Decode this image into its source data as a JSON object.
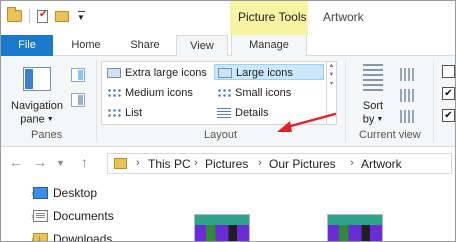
{
  "title_bar": {
    "context_tab": "Picture Tools",
    "window_title": "Artwork"
  },
  "tabs": [
    {
      "label": "File"
    },
    {
      "label": "Home"
    },
    {
      "label": "Share"
    },
    {
      "label": "View",
      "active": true
    },
    {
      "label": "Manage"
    }
  ],
  "ribbon": {
    "panes": {
      "nav_pane_line1": "Navigation",
      "nav_pane_line2": "pane",
      "group_label": "Panes"
    },
    "layout": {
      "options": [
        {
          "label": "Extra large icons",
          "icon": "extra-large-icons-icon"
        },
        {
          "label": "Large icons",
          "icon": "large-icons-icon",
          "selected": true
        },
        {
          "label": "Medium icons",
          "icon": "medium-icons-icon"
        },
        {
          "label": "Small icons",
          "icon": "small-icons-icon"
        },
        {
          "label": "List",
          "icon": "list-icon"
        },
        {
          "label": "Details",
          "icon": "details-icon"
        }
      ],
      "group_label": "Layout"
    },
    "current_view": {
      "sort_line1": "Sort",
      "sort_line2": "by",
      "group_label": "Current view"
    }
  },
  "address_bar": {
    "crumbs": [
      "This PC",
      "Pictures",
      "Our Pictures",
      "Artwork"
    ]
  },
  "nav_tree": [
    {
      "label": "Desktop",
      "icon": "desktop-icon"
    },
    {
      "label": "Documents",
      "icon": "documents-icon"
    },
    {
      "label": "Downloads",
      "icon": "downloads-icon"
    }
  ],
  "colors": {
    "file_tab": "#1979ca",
    "context_tab": "#f7f3a4",
    "selection": "#cce8ff",
    "annotation_arrow": "#e0202a"
  }
}
